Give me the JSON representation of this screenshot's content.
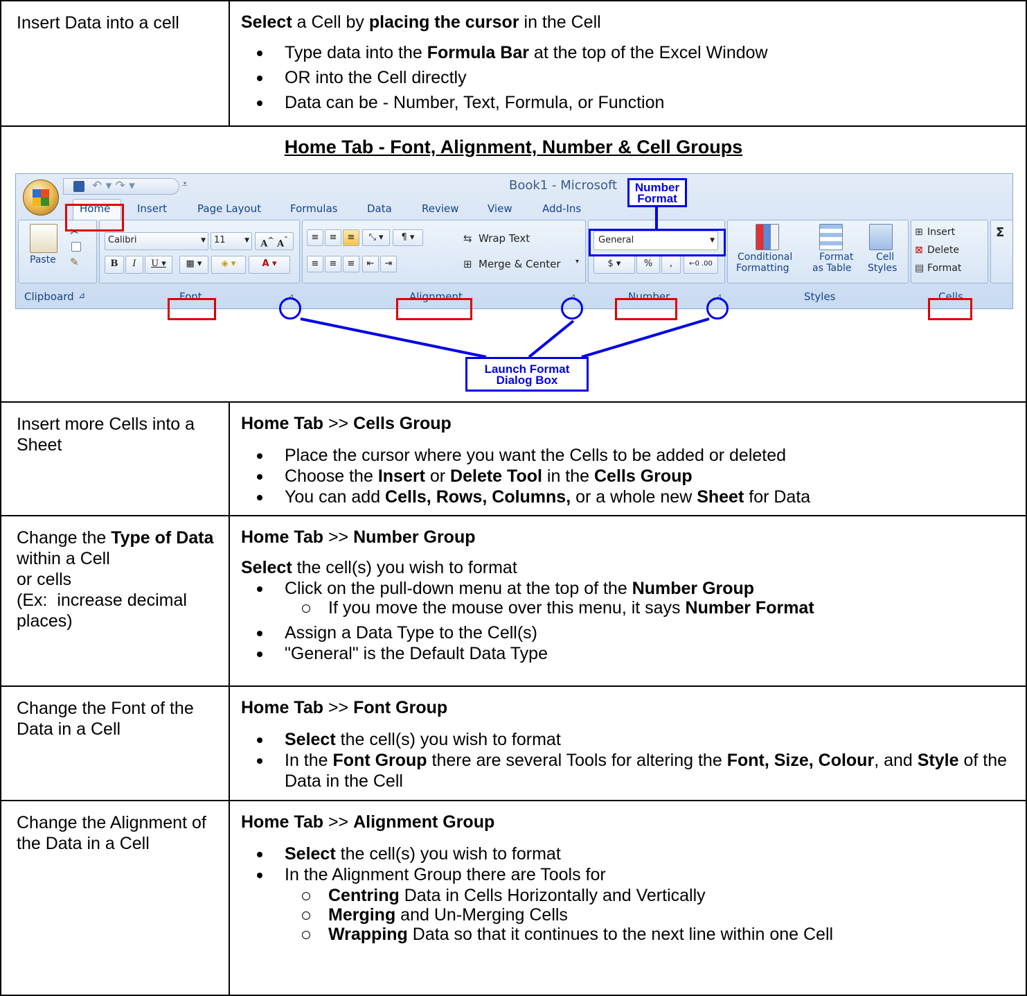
{
  "rows": [
    {
      "label_html": "Insert Data into a cell",
      "intro_html": "<b>Select</b> a Cell by <b>placing the cursor</b> in the Cell",
      "bullets_html": [
        "Type data into the <b>Formula Bar</b> at the top of the Excel Window",
        "OR into the Cell directly",
        "Data can be - Number, Text, Formula, or Function"
      ]
    }
  ],
  "section_title": "Home Tab - Font, Alignment, Number & Cell Groups",
  "ribbon": {
    "window_title": "Book1 - Microsoft",
    "tabs": [
      "Home",
      "Insert",
      "Page Layout",
      "Formulas",
      "Data",
      "Review",
      "View",
      "Add-Ins"
    ],
    "font_name": "Calibri",
    "font_size": "11",
    "wrap_text": "Wrap Text",
    "merge_center": "Merge & Center",
    "number_format": "General",
    "currency": "$",
    "percent": "%",
    "comma": ",",
    "cond_format_1": "Conditional",
    "cond_format_2": "Formatting",
    "format_table_1": "Format",
    "format_table_2": "as Table",
    "cell_styles_1": "Cell",
    "cell_styles_2": "Styles",
    "insert_cells": "Insert",
    "delete_cells": "Delete",
    "format_cells": "Format",
    "paste": "Paste",
    "groups": {
      "clipboard": "Clipboard",
      "font": "Font",
      "alignment": "Alignment",
      "number": "Number",
      "styles": "Styles",
      "cells": "Cells"
    },
    "callout_number_format": [
      "Number",
      "Format"
    ],
    "callout_launch": [
      "Launch Format",
      "Dialog Box"
    ]
  },
  "rows2": [
    {
      "label_html": "Insert more Cells into a Sheet",
      "heading_html": "<b>Home Tab</b> &gt;&gt; <b>Cells Group</b>",
      "bullets_html": [
        "Place the cursor where you want the Cells to be added or deleted",
        "Choose the <b>Insert</b> or <b>Delete Tool</b> in the <b>Cells Group</b>",
        "You can add <b>Cells, Rows, Columns,</b> or a whole new <b>Sheet</b> for Data"
      ]
    },
    {
      "label_html": "Change the <b>Type of Data</b> within a Cell<br>or cells<br>(Ex:&nbsp; increase decimal places)",
      "heading_html": "<b>Home Tab</b> &gt;&gt; <b>Number Group</b>",
      "intro_html": "<b>Select</b> the cell(s) you wish to format",
      "bullet1_html": "Click on the pull-down menu at the top of the <b>Number Group</b>",
      "sub1_html": "If you move the mouse over this menu, it says <b>Number Format</b>",
      "bullets_html": [
        "Assign a Data Type to the Cell(s)",
        "\"General\" is the Default Data Type"
      ]
    },
    {
      "label_html": "Change the Font of the Data in a Cell",
      "heading_html": "<b>Home Tab</b> &gt;&gt; <b>Font Group</b>",
      "bullets_html": [
        "<b>Select</b> the cell(s) you wish to format",
        "In the <b>Font Group</b> there are several Tools for altering the <b>Font, Size, Colour</b>, and <b>Style</b> of the Data in the Cell"
      ]
    },
    {
      "label_html": "Change the Alignment of the Data in a Cell",
      "heading_html": "<b>Home Tab</b> &gt;&gt; <b>Alignment Group</b>",
      "bullets_html": [
        "<b>Select</b> the cell(s) you wish to format",
        "In the Alignment Group there are Tools for"
      ],
      "subs_html": [
        "<b>Centring</b> Data in Cells Horizontally and Vertically",
        "<b>Merging</b> and Un-Merging Cells",
        "<b>Wrapping</b> Data so that it continues to the next line within one Cell"
      ]
    }
  ]
}
